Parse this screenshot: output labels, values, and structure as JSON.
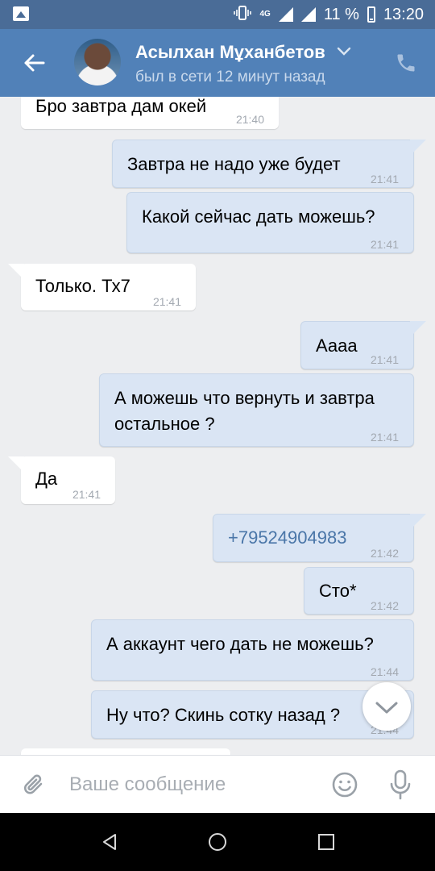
{
  "status_bar": {
    "network": "4G",
    "battery": "11 %",
    "time": "13:20"
  },
  "header": {
    "contact_name": "Асылхан Мұханбетов",
    "last_seen": "был в сети 12 минут назад"
  },
  "messages": [
    {
      "dir": "in",
      "text": "Бро завтра дам окей",
      "time": "21:40"
    },
    {
      "dir": "out",
      "text": "Завтра не надо уже будет",
      "time": "21:41"
    },
    {
      "dir": "out",
      "text": "Какой сейчас дать можешь?",
      "time": "21:41"
    },
    {
      "dir": "in",
      "text": "Только. Тх7",
      "time": "21:41"
    },
    {
      "dir": "out",
      "text": "Аааа",
      "time": "21:41"
    },
    {
      "dir": "out",
      "text_line1": "А можешь что вернуть и завтра",
      "text_line2": "остальное ?",
      "time": "21:41"
    },
    {
      "dir": "in",
      "text": "Да",
      "time": "21:41"
    },
    {
      "dir": "out",
      "text": "+79524904983",
      "time": "21:42"
    },
    {
      "dir": "out",
      "text": "Сто*",
      "time": "21:42"
    },
    {
      "dir": "out",
      "text": "А аккаунт чего дать не можешь?",
      "time": "21:44"
    },
    {
      "dir": "out",
      "text": "Ну что? Скинь сотку назад ?",
      "time": "21:44"
    }
  ],
  "composer": {
    "placeholder": "Ваше сообщение"
  },
  "colors": {
    "header": "#5181b8",
    "status_bar": "#4a6c97",
    "outgoing": "#dae5f4",
    "incoming": "#ffffff",
    "link": "#4a76a8"
  }
}
